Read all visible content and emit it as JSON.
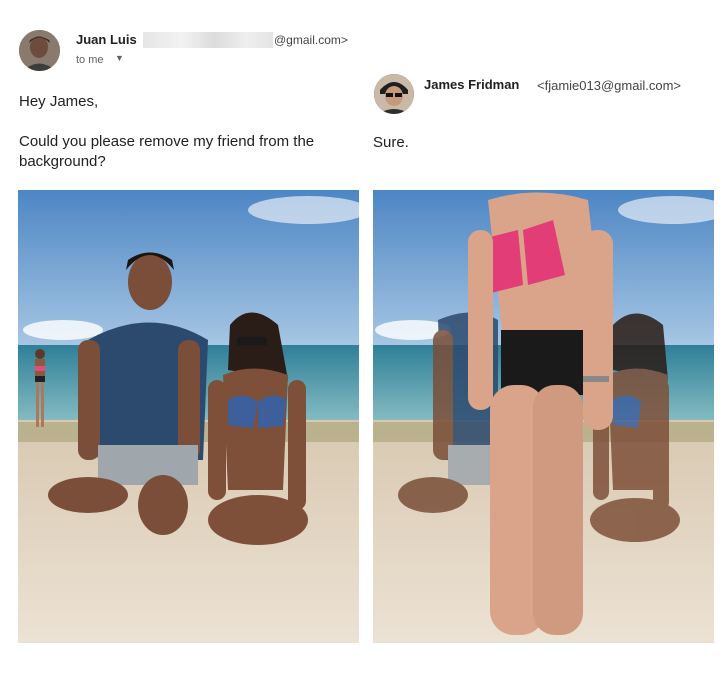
{
  "left_email": {
    "sender_name": "Juan Luis",
    "sender_email_domain": "@gmail.com>",
    "recipient_label": "to me",
    "caret_icon": "caret-down-icon",
    "greeting": "Hey James,",
    "message": "Could you please remove my friend from the background?"
  },
  "right_email": {
    "sender_name": "James Fridman",
    "sender_email": "<fjamie013@gmail.com>",
    "message": "Sure."
  },
  "colors": {
    "sky": "#5d8fc7",
    "sea": "#4f9fae",
    "sand": "#e6d7c2"
  }
}
